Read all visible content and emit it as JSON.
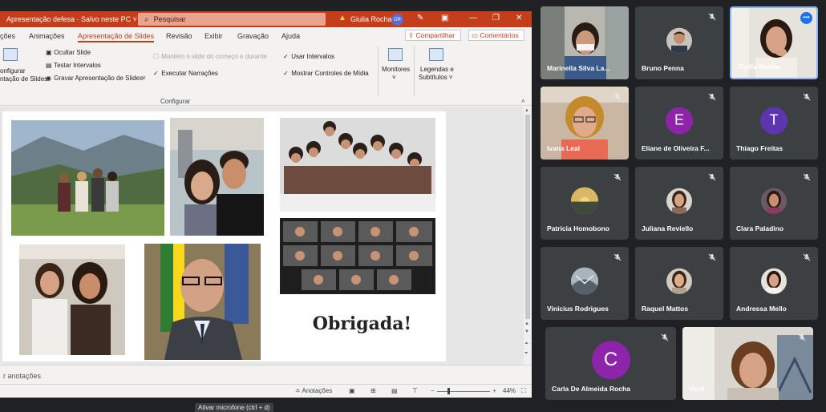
{
  "ppt": {
    "doc_title": "Apresentação defesa · Salvo neste PC ˅",
    "search_placeholder": "Pesquisar",
    "user_name": "Giulia Rocha",
    "user_initials": "GR",
    "tabs": [
      "ções",
      "Animações",
      "Apresentação de Slides",
      "Revisão",
      "Exibir",
      "Gravação",
      "Ajuda"
    ],
    "share_label": "Compartilhar",
    "comments_label": "Comentários",
    "ribbon": {
      "configure_label_1": "onfigurar",
      "configure_label_2": "ntação de Slides",
      "hide_slide": "Ocultar Slide",
      "test_timings": "Testar Intervalos",
      "record_slideshow": "Gravar Apresentação de Slides",
      "play_narrations": "Executar Narrações",
      "use_timings": "Usar Intervalos",
      "show_media_controls": "Mostrar Controles de Mídia",
      "dim_option": "Mantém o slide do começo e durante",
      "monitors": "Monitores",
      "captions_1": "Legendas e",
      "captions_2": "Subtítulos ˅",
      "group_label": "Configurar"
    },
    "slide": {
      "closing_text": "Obrigada!"
    },
    "notes_label": "r anotações",
    "status": {
      "notes_button": "Anotações",
      "zoom": "44%"
    },
    "tooltip": "Ativar microfone (ctrl + d)"
  },
  "participants": [
    {
      "name": "Marinella Silva La...",
      "muted": false,
      "kind": "video"
    },
    {
      "name": "Bruno Penna",
      "muted": true,
      "kind": "photo"
    },
    {
      "name": "Giulia Rocha",
      "muted": false,
      "kind": "video",
      "speaking": true
    },
    {
      "name": "Ivana Leal",
      "muted": true,
      "kind": "video"
    },
    {
      "name": "Eliane de Oliveira F...",
      "muted": true,
      "kind": "letter",
      "letter": "E",
      "color": "#8e24aa"
    },
    {
      "name": "Thiago Freitas",
      "muted": true,
      "kind": "letter",
      "letter": "T",
      "color": "#5e35b1"
    },
    {
      "name": "Patricia Homobono",
      "muted": true,
      "kind": "photo"
    },
    {
      "name": "Juliana Reviello",
      "muted": true,
      "kind": "photo"
    },
    {
      "name": "Clara Paladino",
      "muted": true,
      "kind": "photo"
    },
    {
      "name": "Vinicius Rodrigues",
      "muted": true,
      "kind": "photo"
    },
    {
      "name": "Raquel Mattos",
      "muted": true,
      "kind": "photo"
    },
    {
      "name": "Andressa Mello",
      "muted": true,
      "kind": "photo"
    },
    {
      "name": "Carla De Almeida Rocha",
      "muted": true,
      "kind": "letter",
      "letter": "C",
      "color": "#8e24aa"
    },
    {
      "name": "Você",
      "muted": true,
      "kind": "video"
    }
  ],
  "colors": {
    "ppt_accent": "#c43e1c",
    "meet_bg": "#202124",
    "tile_bg": "#3c4043",
    "speaking_border": "#8ab4f8"
  }
}
